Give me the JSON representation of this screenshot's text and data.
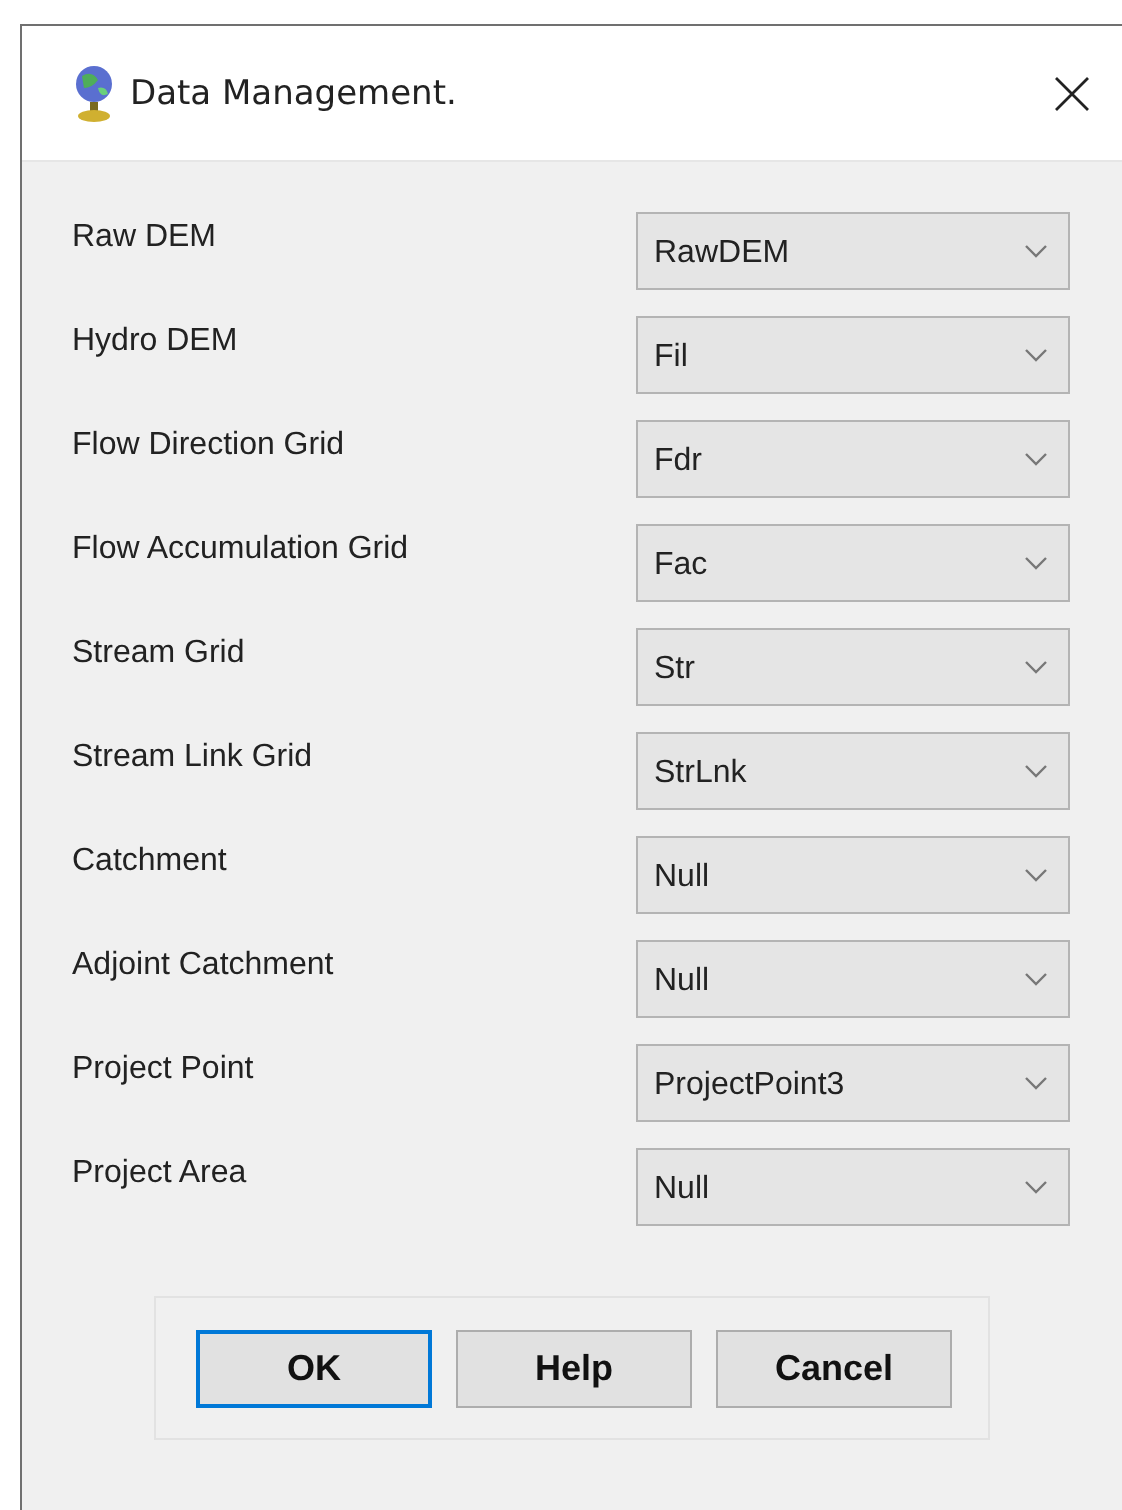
{
  "window": {
    "title": "Data Management."
  },
  "fields": [
    {
      "label": "Raw DEM",
      "value": "RawDEM"
    },
    {
      "label": "Hydro DEM",
      "value": "Fil"
    },
    {
      "label": "Flow Direction Grid",
      "value": "Fdr"
    },
    {
      "label": "Flow Accumulation Grid",
      "value": "Fac"
    },
    {
      "label": "Stream Grid",
      "value": "Str"
    },
    {
      "label": "Stream Link Grid",
      "value": "StrLnk"
    },
    {
      "label": "Catchment",
      "value": "Null"
    },
    {
      "label": "Adjoint Catchment",
      "value": "Null"
    },
    {
      "label": "Project Point",
      "value": "ProjectPoint3"
    },
    {
      "label": "Project Area",
      "value": "Null"
    }
  ],
  "buttons": [
    {
      "label": "OK",
      "focused": true
    },
    {
      "label": "Help",
      "focused": false
    },
    {
      "label": "Cancel",
      "focused": false
    }
  ]
}
